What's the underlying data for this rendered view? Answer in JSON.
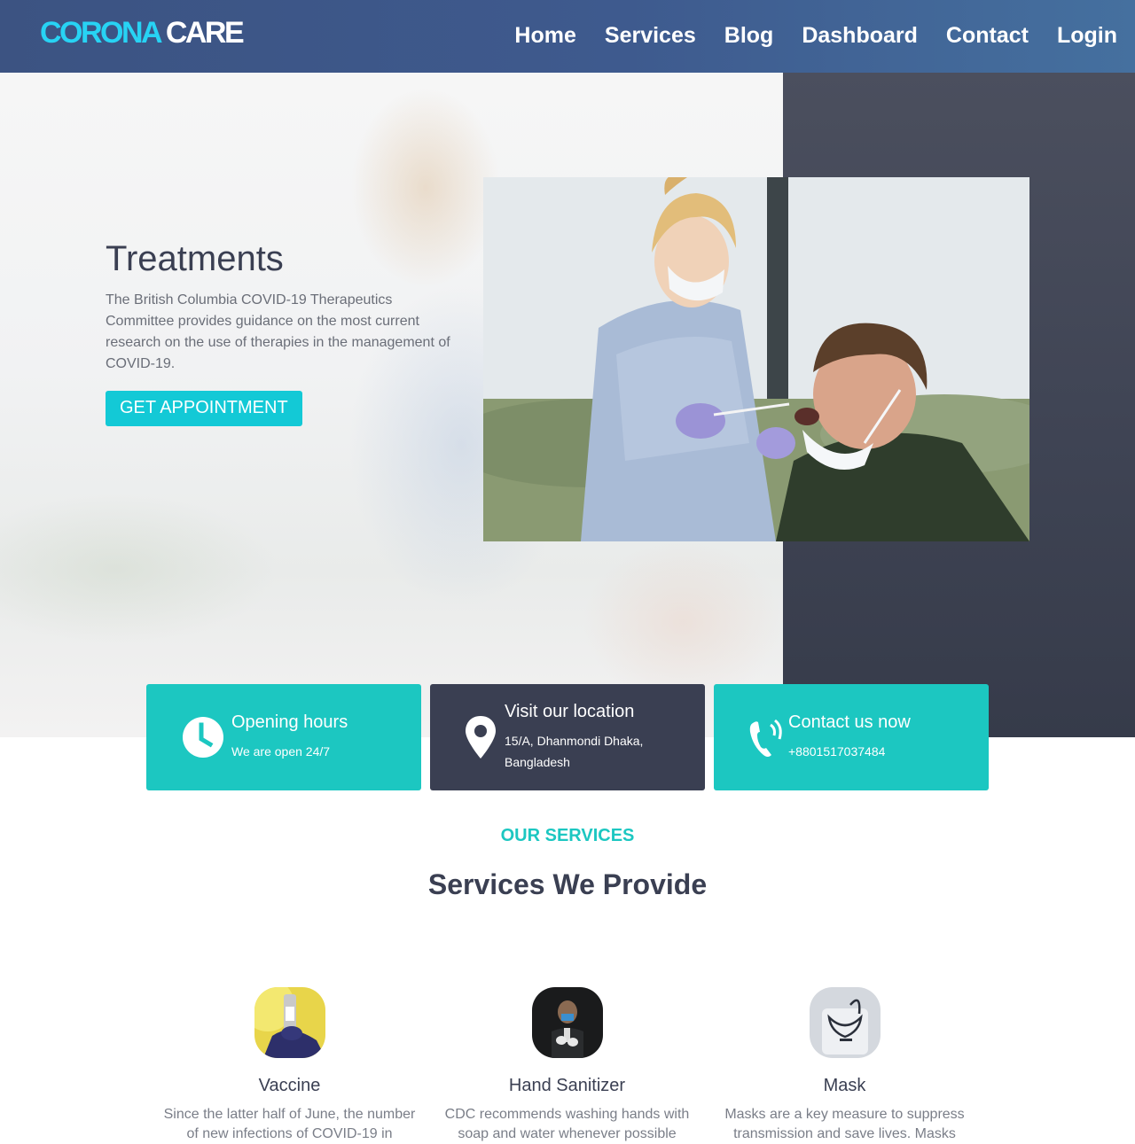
{
  "brand": {
    "part1": "CORONA",
    "part2": "CARE"
  },
  "nav": {
    "items": [
      "Home",
      "Services",
      "Blog",
      "Dashboard",
      "Contact",
      "Login"
    ]
  },
  "hero": {
    "title": "Treatments",
    "description": "The British Columbia COVID-19 Therapeutics Committee provides guidance on the most current research on the use of therapies in the management of COVID-19.",
    "button_label": "GET APPOINTMENT"
  },
  "info_cards": [
    {
      "title": "Opening hours",
      "text": "We are open 24/7",
      "icon": "clock-icon"
    },
    {
      "title": "Visit our location",
      "text": "15/A, Dhanmondi Dhaka, Bangladesh",
      "icon": "location-pin-icon"
    },
    {
      "title": "Contact us now",
      "text": "+8801517037484",
      "icon": "phone-icon"
    }
  ],
  "services_section": {
    "subtitle": "OUR SERVICES",
    "title": "Services We Provide",
    "items": [
      {
        "name": "Vaccine",
        "description": "Since the latter half of June, the number of new infections of COVID-19 in"
      },
      {
        "name": "Hand Sanitizer",
        "description": "CDC recommends washing hands with soap and water whenever possible"
      },
      {
        "name": "Mask",
        "description": "Masks are a key measure to suppress transmission and save lives. Masks"
      }
    ]
  },
  "colors": {
    "accent": "#1cc7c1",
    "dark": "#3a3f52",
    "brand_cyan": "#27d3f4",
    "navbar": "#3e5a8e"
  }
}
